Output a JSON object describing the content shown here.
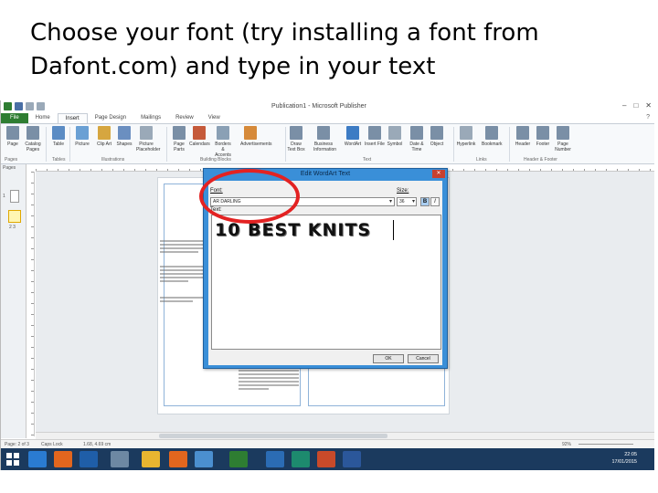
{
  "slide": {
    "title": "Choose your font (try installing a font from Dafont.com) and type in your text"
  },
  "window": {
    "title": "Publication1 - Microsoft Publisher",
    "controls": [
      "–",
      "□",
      "✕"
    ]
  },
  "tabs": [
    {
      "label": "File"
    },
    {
      "label": "Home"
    },
    {
      "label": "Insert"
    },
    {
      "label": "Page Design"
    },
    {
      "label": "Mailings"
    },
    {
      "label": "Review"
    },
    {
      "label": "View"
    }
  ],
  "ribbon": {
    "buttons": [
      {
        "label": "Page",
        "color": "#7a8fa6"
      },
      {
        "label": "Catalog Pages",
        "color": "#7a8fa6"
      },
      {
        "label": "Table",
        "color": "#5b8cc4"
      },
      {
        "label": "Picture",
        "color": "#6aa0d4"
      },
      {
        "label": "Clip Art",
        "color": "#d6a640"
      },
      {
        "label": "Shapes",
        "color": "#6b8fc0"
      },
      {
        "label": "Picture Placeholder",
        "color": "#9aa9b8"
      },
      {
        "label": "Page Parts",
        "color": "#7a8fa6"
      },
      {
        "label": "Calendars",
        "color": "#c55a3a"
      },
      {
        "label": "Borders & Accents",
        "color": "#8aa0b5"
      },
      {
        "label": "Advertisements",
        "color": "#d68a3a"
      },
      {
        "label": "Draw Text Box",
        "color": "#7a8fa6"
      },
      {
        "label": "Business Information",
        "color": "#7a8fa6"
      },
      {
        "label": "WordArt",
        "color": "#3d7cc4"
      },
      {
        "label": "Insert File",
        "color": "#7a8fa6"
      },
      {
        "label": "Symbol",
        "color": "#9aa9b8"
      },
      {
        "label": "Date & Time",
        "color": "#7a8fa6"
      },
      {
        "label": "Object",
        "color": "#7a8fa6"
      },
      {
        "label": "Hyperlink",
        "color": "#9aa9b8"
      },
      {
        "label": "Bookmark",
        "color": "#7a8fa6"
      },
      {
        "label": "Header",
        "color": "#7a8fa6"
      },
      {
        "label": "Footer",
        "color": "#7a8fa6"
      },
      {
        "label": "Page Number",
        "color": "#7a8fa6"
      }
    ],
    "groups": [
      "Pages",
      "Tables",
      "Illustrations",
      "Building Blocks",
      "Text",
      "Links",
      "Header & Footer"
    ]
  },
  "pages_panel": {
    "label": "Pages",
    "page_numbers": [
      "1",
      "2  3"
    ]
  },
  "dialog": {
    "title": "Edit WordArt Text",
    "font_label": "Font:",
    "font_value": "AR DARLING",
    "size_label": "Size:",
    "size_value": "36",
    "bold_label": "B",
    "italic_label": "I",
    "text_label": "Text:",
    "text_value": "10 BEST KNITS",
    "ok_label": "OK",
    "cancel_label": "Cancel"
  },
  "status": {
    "page": "Page: 2 of 3",
    "caps": "Caps Lock",
    "position": "1.68, 4.69 cm",
    "zoom": "92%"
  },
  "taskbar": {
    "time": "22:05",
    "date": "17/01/2015",
    "apps": [
      {
        "name": "internet-explorer",
        "color": "#2a7bd1"
      },
      {
        "name": "firefox",
        "color": "#e2661e"
      },
      {
        "name": "hp",
        "color": "#1f5ea8"
      },
      {
        "name": "calculator",
        "color": "#6d88a3"
      },
      {
        "name": "file-explorer",
        "color": "#e8b530"
      },
      {
        "name": "firefox-2",
        "color": "#e2661e"
      },
      {
        "name": "paint",
        "color": "#4b8fcf"
      },
      {
        "name": "excel",
        "color": "#2e7d32"
      },
      {
        "name": "outlook",
        "color": "#2b6cb4"
      },
      {
        "name": "publisher",
        "color": "#1d8a6e"
      },
      {
        "name": "powerpoint",
        "color": "#c84a2a"
      },
      {
        "name": "word",
        "color": "#2b579a"
      }
    ]
  },
  "colors": {
    "file_tab": "#2e7d32",
    "dialog_frame": "#3a8fd8",
    "highlight_ellipse": "#e32222",
    "taskbar": "#1b3a5e"
  }
}
